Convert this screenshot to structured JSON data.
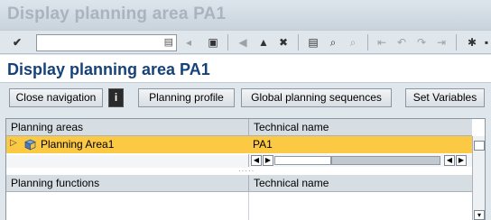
{
  "window": {
    "title": "Display planning area PA1"
  },
  "toolbar": {
    "command_value": "",
    "icons": [
      "enter-icon",
      "back-icon",
      "save-icon",
      "exit-icon",
      "up-icon",
      "cancel-icon",
      "print-icon",
      "find-icon",
      "find-next-icon",
      "first-page-icon",
      "prev-page-icon",
      "next-page-icon",
      "last-page-icon",
      "new-session-icon"
    ]
  },
  "page": {
    "title": "Display planning area PA1"
  },
  "appbar": {
    "close_navigation": "Close navigation",
    "info_icon": "i",
    "planning_profile": "Planning profile",
    "global_planning_sequences": "Global planning sequences",
    "set_variables": "Set Variables"
  },
  "areas_table": {
    "headers": [
      "Planning areas",
      "Technical name"
    ],
    "rows": [
      {
        "name": "Planning Area1",
        "technical": "PA1",
        "selected": true
      }
    ]
  },
  "functions_table": {
    "headers": [
      "Planning functions",
      "Technical name"
    ]
  },
  "colors": {
    "selected_row": "#fcc944",
    "title": "#16427a"
  }
}
